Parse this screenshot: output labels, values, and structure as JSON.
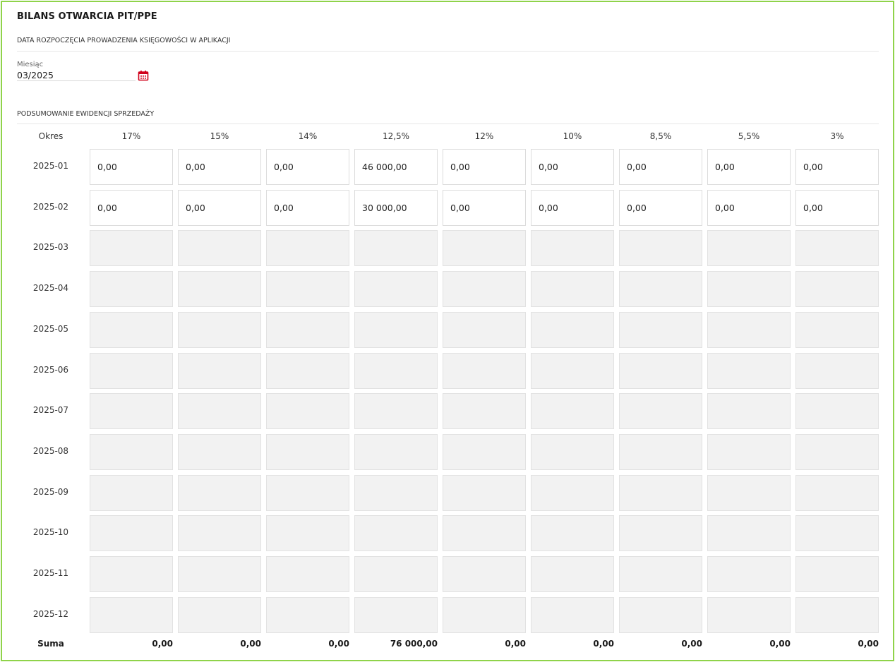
{
  "title": "BILANS OTWARCIA PIT/PPE",
  "start_section": {
    "heading": "DATA ROZPOCZĘCIA PROWADZENIA KSIĘGOWOŚCI W APLIKACJI",
    "month_label": "Miesiąc",
    "month_value": "03/2025",
    "calendar_icon": "calendar-icon",
    "accent_color": "#d0021b"
  },
  "summary_section": {
    "heading": "PODSUMOWANIE EWIDENCJI SPRZEDAŻY",
    "period_header": "Okres",
    "rate_headers": [
      "17%",
      "15%",
      "14%",
      "12,5%",
      "12%",
      "10%",
      "8,5%",
      "5,5%",
      "3%"
    ],
    "rows": [
      {
        "period": "2025-01",
        "editable": true,
        "values": [
          "0,00",
          "0,00",
          "0,00",
          "46 000,00",
          "0,00",
          "0,00",
          "0,00",
          "0,00",
          "0,00"
        ]
      },
      {
        "period": "2025-02",
        "editable": true,
        "values": [
          "0,00",
          "0,00",
          "0,00",
          "30 000,00",
          "0,00",
          "0,00",
          "0,00",
          "0,00",
          "0,00"
        ]
      },
      {
        "period": "2025-03",
        "editable": false,
        "values": [
          "",
          "",
          "",
          "",
          "",
          "",
          "",
          "",
          ""
        ]
      },
      {
        "period": "2025-04",
        "editable": false,
        "values": [
          "",
          "",
          "",
          "",
          "",
          "",
          "",
          "",
          ""
        ]
      },
      {
        "period": "2025-05",
        "editable": false,
        "values": [
          "",
          "",
          "",
          "",
          "",
          "",
          "",
          "",
          ""
        ]
      },
      {
        "period": "2025-06",
        "editable": false,
        "values": [
          "",
          "",
          "",
          "",
          "",
          "",
          "",
          "",
          ""
        ]
      },
      {
        "period": "2025-07",
        "editable": false,
        "values": [
          "",
          "",
          "",
          "",
          "",
          "",
          "",
          "",
          ""
        ]
      },
      {
        "period": "2025-08",
        "editable": false,
        "values": [
          "",
          "",
          "",
          "",
          "",
          "",
          "",
          "",
          ""
        ]
      },
      {
        "period": "2025-09",
        "editable": false,
        "values": [
          "",
          "",
          "",
          "",
          "",
          "",
          "",
          "",
          ""
        ]
      },
      {
        "period": "2025-10",
        "editable": false,
        "values": [
          "",
          "",
          "",
          "",
          "",
          "",
          "",
          "",
          ""
        ]
      },
      {
        "period": "2025-11",
        "editable": false,
        "values": [
          "",
          "",
          "",
          "",
          "",
          "",
          "",
          "",
          ""
        ]
      },
      {
        "period": "2025-12",
        "editable": false,
        "values": [
          "",
          "",
          "",
          "",
          "",
          "",
          "",
          "",
          ""
        ]
      }
    ],
    "sum_label": "Suma",
    "sums": [
      "0,00",
      "0,00",
      "0,00",
      "76 000,00",
      "0,00",
      "0,00",
      "0,00",
      "0,00",
      "0,00"
    ]
  },
  "colors": {
    "frame_border": "#8fd34a",
    "disabled_cell": "#f2f2f2"
  }
}
